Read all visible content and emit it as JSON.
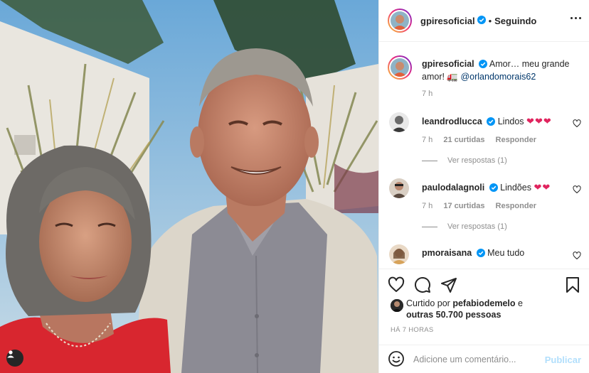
{
  "post": {
    "author": "gpiresoficial",
    "follow_state": "Seguindo",
    "dot": "•",
    "caption": "Amor… meu grande amor! 🚛 ",
    "caption_mention": "@orlandomorais62",
    "time": "7 h"
  },
  "comments": [
    {
      "user": "leandrodlucca",
      "text": "Lindos",
      "emoji": "❤❤❤",
      "time": "7 h",
      "likes": "21 curtidas",
      "reply": "Responder",
      "view_replies": "Ver respostas (1)"
    },
    {
      "user": "paulodalagnoli",
      "text": "Lindões",
      "emoji": "❤❤",
      "time": "7 h",
      "likes": "17 curtidas",
      "reply": "Responder",
      "view_replies": "Ver respostas (1)"
    },
    {
      "user": "pmoraisana",
      "text": "Meu tudo",
      "emoji": ""
    }
  ],
  "likes": {
    "prefix": "Curtido por ",
    "user": "pefabiodemelo",
    "mid": " e",
    "others": "outras 50.700 pessoas"
  },
  "posted_ago": "HÁ 7 HORAS",
  "add_comment": {
    "placeholder": "Adicione um comentário...",
    "publish": "Publicar"
  },
  "icons": {
    "like": "heart-icon",
    "comment": "comment-icon",
    "share": "share-icon",
    "save": "bookmark-icon",
    "emoji": "emoji-icon",
    "more": "more-icon",
    "verified": "verified-badge-icon",
    "user_tag": "user-tag-icon"
  },
  "colors": {
    "verified": "#0095f6",
    "heart_red": "#e0245e",
    "link": "#00376b",
    "muted": "#8e8e8e",
    "publish_disabled": "#b2dffc"
  }
}
